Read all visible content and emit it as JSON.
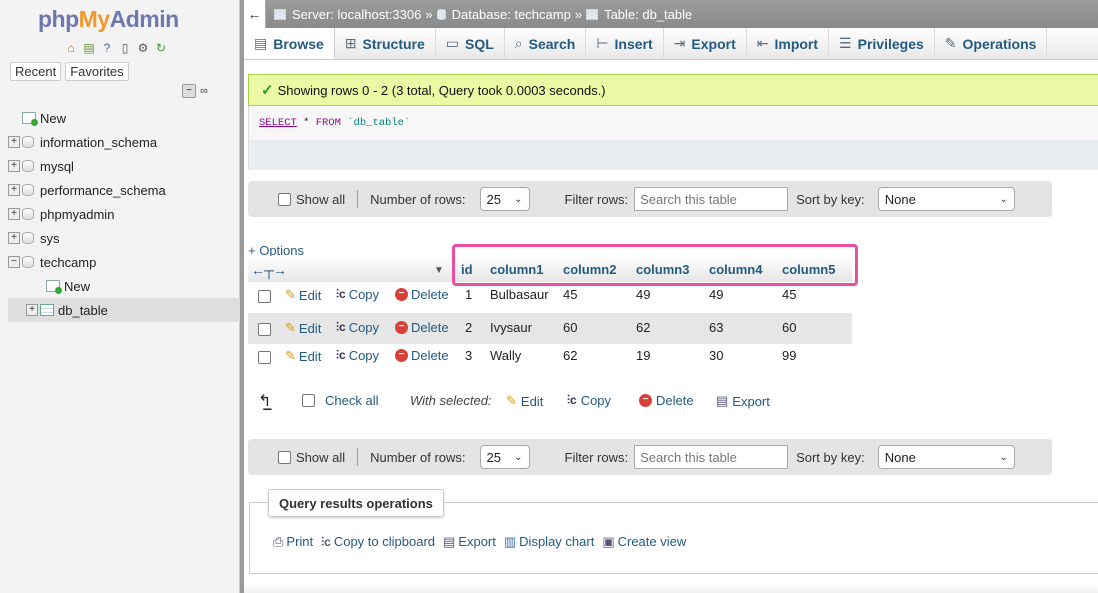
{
  "sidebar": {
    "logo": {
      "php": "php",
      "my": "My",
      "admin": "Admin"
    },
    "icons": [
      "home-icon",
      "exit-icon",
      "help-icon",
      "docs-icon",
      "settings-icon",
      "reload-icon"
    ],
    "tabs": [
      "Recent",
      "Favorites"
    ],
    "tree": [
      {
        "label": "New",
        "type": "new"
      },
      {
        "label": "information_schema",
        "type": "db"
      },
      {
        "label": "mysql",
        "type": "db"
      },
      {
        "label": "performance_schema",
        "type": "db"
      },
      {
        "label": "phpmyadmin",
        "type": "db"
      },
      {
        "label": "sys",
        "type": "db"
      },
      {
        "label": "techcamp",
        "type": "db",
        "expanded": true
      },
      {
        "label": "New",
        "type": "new",
        "child": true
      },
      {
        "label": "db_table",
        "type": "table",
        "child": true,
        "selected": true
      }
    ]
  },
  "breadcrumb": {
    "server": "Server: localhost:3306",
    "database": "Database: techcamp",
    "table": "Table: db_table",
    "sep": "»"
  },
  "tabs": [
    "Browse",
    "Structure",
    "SQL",
    "Search",
    "Insert",
    "Export",
    "Import",
    "Privileges",
    "Operations"
  ],
  "message": "Showing rows 0 - 2 (3 total, Query took 0.0003 seconds.)",
  "sql": {
    "select": "SELECT",
    "star": " * ",
    "from": "FROM",
    "table": " `db_table`"
  },
  "navbar": {
    "show_all": "Show all",
    "rows_label": "Number of rows:",
    "rows_value": "25",
    "filter_label": "Filter rows:",
    "filter_placeholder": "Search this table",
    "sort_label": "Sort by key:",
    "sort_value": "None"
  },
  "options_label": "+ Options",
  "columns": [
    "id",
    "column1",
    "column2",
    "column3",
    "column4",
    "column5"
  ],
  "row_actions": {
    "edit": "Edit",
    "copy": "Copy",
    "delete": "Delete"
  },
  "rows": [
    [
      "1",
      "Bulbasaur",
      "45",
      "49",
      "49",
      "45"
    ],
    [
      "2",
      "Ivysaur",
      "60",
      "62",
      "63",
      "60"
    ],
    [
      "3",
      "Wally",
      "62",
      "19",
      "30",
      "99"
    ]
  ],
  "bulk": {
    "check_all": "Check all",
    "with_selected": "With selected:",
    "edit": "Edit",
    "copy": "Copy",
    "delete": "Delete",
    "export": "Export"
  },
  "query_ops": {
    "title": "Query results operations",
    "links": [
      "Print",
      "Copy to clipboard",
      "Export",
      "Display chart",
      "Create view"
    ]
  },
  "colors": {
    "accent": "#235a81",
    "highlight": "#e94f9e",
    "success_bg": "#ebf8a4"
  }
}
